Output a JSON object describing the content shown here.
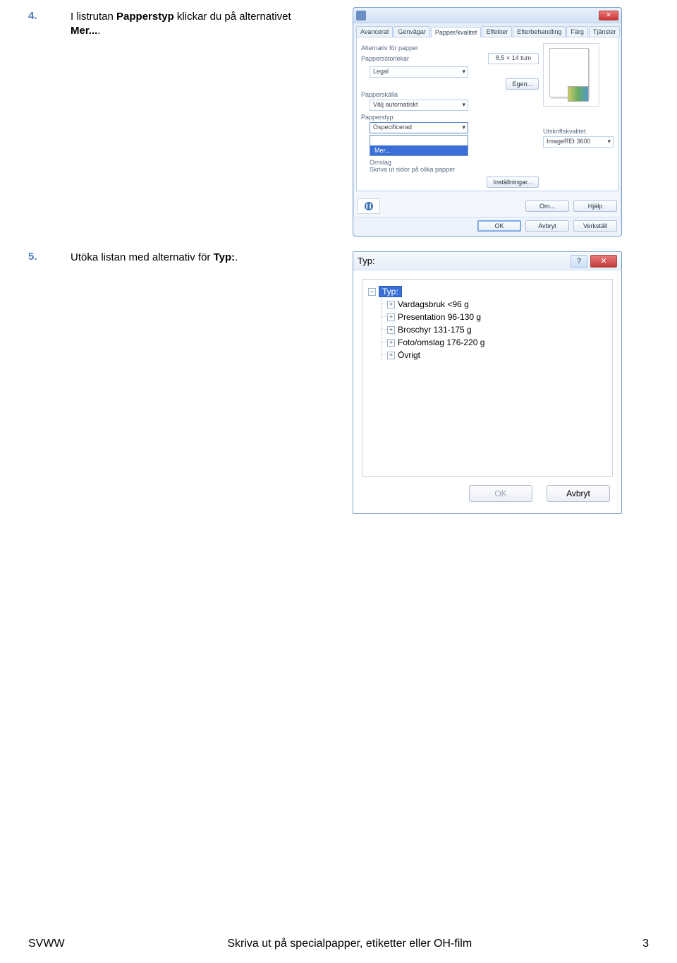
{
  "steps": [
    {
      "num": "4.",
      "pre": "I listrutan ",
      "bold1": "Papperstyp",
      "mid": " klickar du på alternativet ",
      "bold2": "Mer...",
      "post": "."
    },
    {
      "num": "5.",
      "pre": "Utöka listan med alternativ för ",
      "bold1": "Typ:",
      "mid": "",
      "bold2": "",
      "post": "."
    }
  ],
  "dlg1": {
    "tabs": [
      "Avancerat",
      "Genvägar",
      "Papper/kvalitet",
      "Effekter",
      "Efterbehandling",
      "Färg",
      "Tjänster"
    ],
    "active_tab_idx": 2,
    "grp_alt": "Alternativ för papper",
    "lbl_size": "Pappersstorlekar",
    "size_val": "8,5 × 14 tum",
    "dd_legal": "Legal",
    "btn_egen": "Egen...",
    "lbl_kalla": "Papperskälla",
    "dd_kalla": "Välj automatiskt",
    "lbl_typ": "Papperstyp:",
    "dd_typ": "Ospecificerad",
    "dd_open_sel": "Mer...",
    "lbl_under1": "Omslag",
    "lbl_under2": "Skriva ut sidor på olika papper",
    "btn_install": "Inställningar...",
    "lbl_quality": "Utskriftskvalitet",
    "dd_quality": "ImageREt 3600",
    "btn_om": "Om...",
    "btn_help": "Hjälp",
    "btn_ok": "OK",
    "btn_avbryt": "Avbryt",
    "btn_verkstall": "Verkställ"
  },
  "dlg2": {
    "title": "Typ:",
    "root": "Typ:",
    "items": [
      "Vardagsbruk <96 g",
      "Presentation 96-130 g",
      "Broschyr 131-175 g",
      "Foto/omslag 176-220 g",
      "Övrigt"
    ],
    "btn_ok": "OK",
    "btn_avbryt": "Avbryt"
  },
  "footer": {
    "left": "SVWW",
    "center": "Skriva ut på specialpapper, etiketter eller OH-film",
    "page": "3"
  }
}
